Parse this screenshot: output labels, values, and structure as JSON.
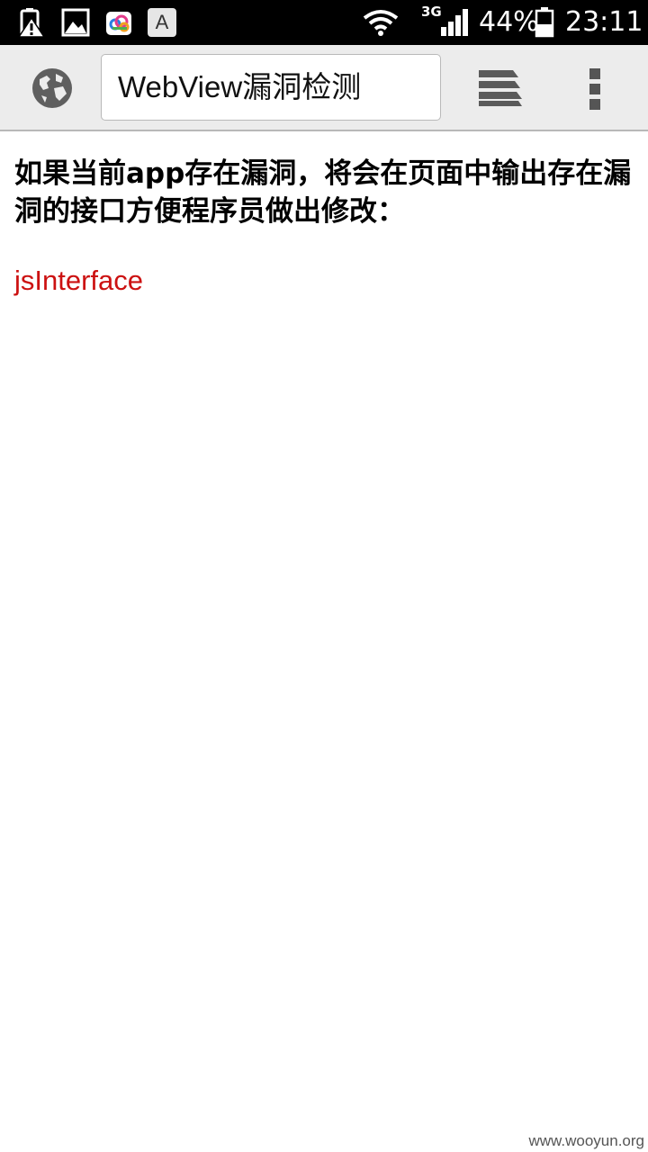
{
  "status_bar": {
    "network_type": "3G",
    "battery_percent": "44%",
    "time": "23:11",
    "notification_icons": [
      "battery-warning-icon",
      "gallery-icon",
      "cloud-icon",
      "keyboard-a-icon"
    ],
    "status_icons": [
      "wifi-icon",
      "signal-icon",
      "battery-icon"
    ],
    "keyboard_icon_letter": "A"
  },
  "toolbar": {
    "url_text": "WebView漏洞检测",
    "icons": [
      "globe-icon",
      "tabs-icon",
      "overflow-menu-icon"
    ]
  },
  "page": {
    "heading": "如果当前app存在漏洞，将会在页面中输出存在漏洞的接口方便程序员做出修改：",
    "result": "jsInterface",
    "result_color": "#cc1111"
  },
  "watermark": "www.wooyun.org"
}
